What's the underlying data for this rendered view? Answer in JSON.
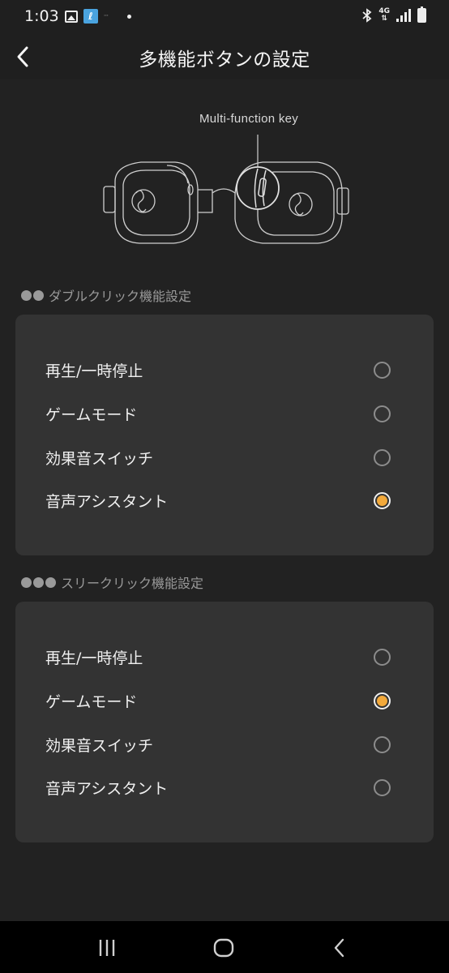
{
  "status": {
    "time": "1:03",
    "network": "4G"
  },
  "header": {
    "title": "多機能ボタンの設定"
  },
  "illustration": {
    "key_label": "Multi-function key"
  },
  "double_click": {
    "label": "ダブルクリック機能設定",
    "options": [
      {
        "label": "再生/一時停止",
        "selected": false
      },
      {
        "label": "ゲームモード",
        "selected": false
      },
      {
        "label": "効果音スイッチ",
        "selected": false
      },
      {
        "label": "音声アシスタント",
        "selected": true
      }
    ]
  },
  "triple_click": {
    "label": "スリークリック機能設定",
    "options": [
      {
        "label": "再生/一時停止",
        "selected": false
      },
      {
        "label": "ゲームモード",
        "selected": true
      },
      {
        "label": "効果音スイッチ",
        "selected": false
      },
      {
        "label": "音声アシスタント",
        "selected": false
      }
    ]
  },
  "colors": {
    "background": "#222222",
    "card": "#333333",
    "accent": "#f2a93b"
  },
  "icons": [
    "gallery-icon",
    "app-notification-icon",
    "bluetooth-icon",
    "signal-icon",
    "battery-icon",
    "back-arrow-icon",
    "headphones-illustration",
    "recents-icon",
    "home-icon",
    "nav-back-icon"
  ]
}
